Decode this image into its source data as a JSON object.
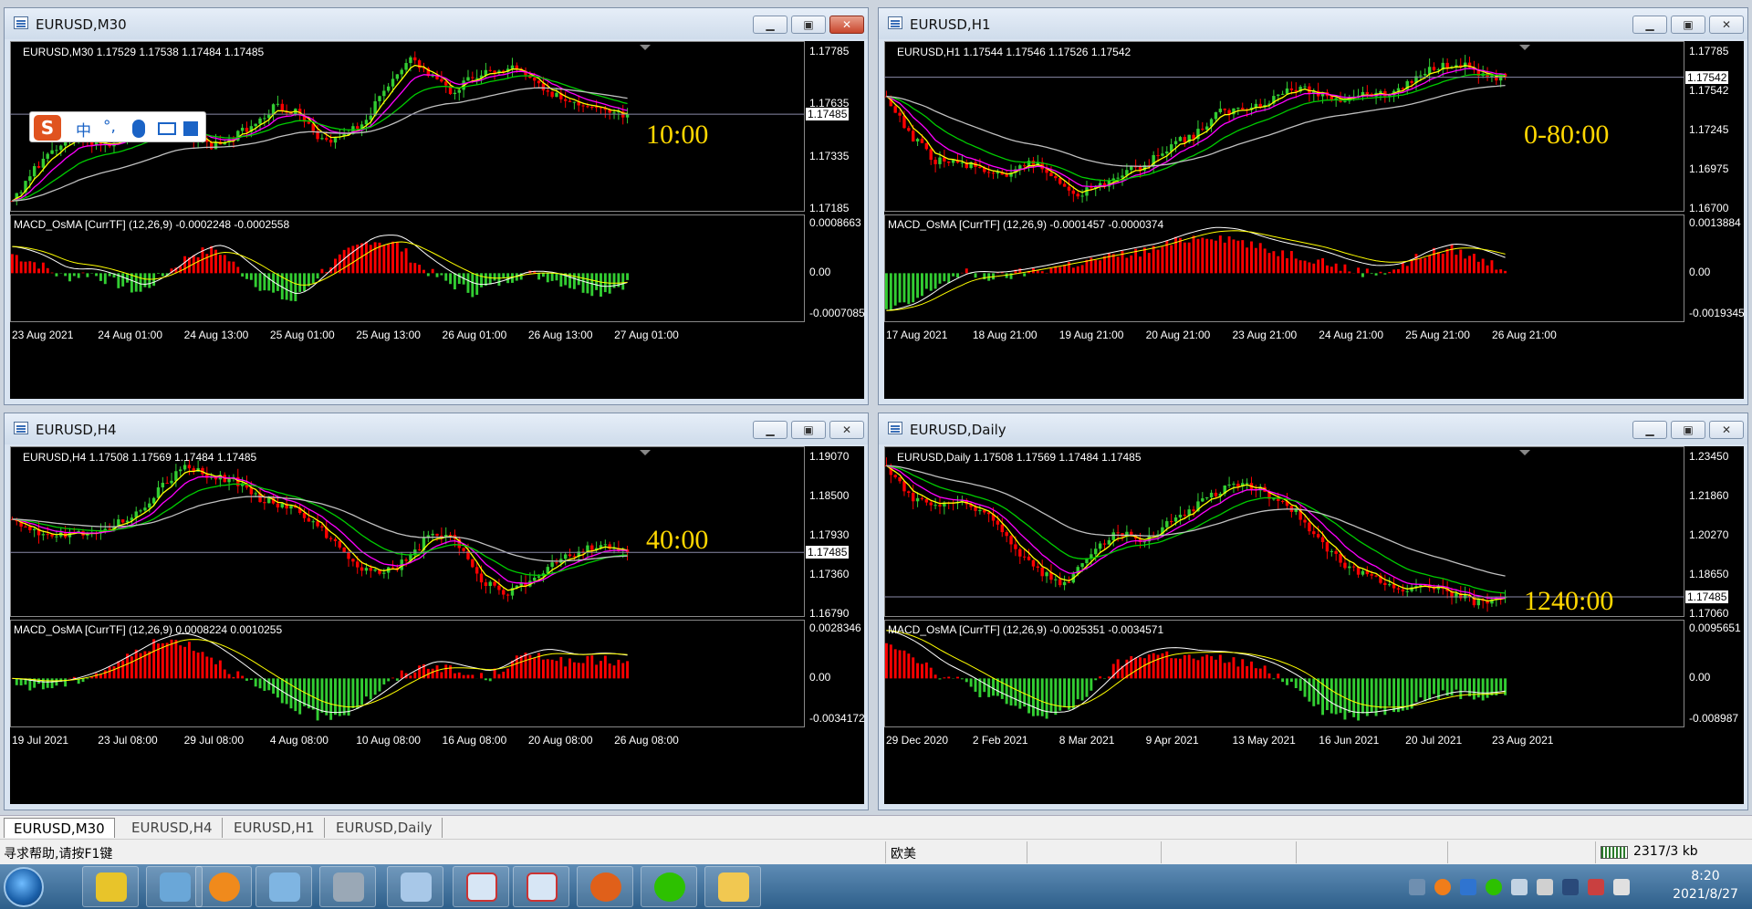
{
  "windows": [
    {
      "id": "m30",
      "title": "EURUSD,M30",
      "ohlc": "EURUSD,M30  1.17529 1.17538 1.17484 1.17485",
      "price_ticks": [
        "1.17785",
        "1.17635",
        "1.17335",
        "1.17185"
      ],
      "current_price": "1.17485",
      "tf_overlay": "10:00",
      "indicator_label": "MACD_OsMA [CurrTF] (12,26,9) -0.0002248 -0.0002558",
      "ind_ticks": [
        "0.0008663",
        "0.00",
        "-0.0007085"
      ],
      "date_ticks": [
        "23 Aug 2021",
        "24 Aug 01:00",
        "24 Aug 13:00",
        "25 Aug 01:00",
        "25 Aug 13:00",
        "26 Aug 01:00",
        "26 Aug 13:00",
        "27 Aug 01:00"
      ],
      "active": true
    },
    {
      "id": "h1",
      "title": "EURUSD,H1",
      "ohlc": "EURUSD,H1  1.17544 1.17546 1.17526 1.17542",
      "price_ticks": [
        "1.17785",
        "1.17542",
        "1.17245",
        "1.16975",
        "1.16700"
      ],
      "current_price": "1.17542",
      "tf_overlay": "0-80:00",
      "indicator_label": "MACD_OsMA [CurrTF] (12,26,9) -0.0001457 -0.0000374",
      "ind_ticks": [
        "0.0013884",
        "0.00",
        "-0.0019345"
      ],
      "date_ticks": [
        "17 Aug 2021",
        "18 Aug 21:00",
        "19 Aug 21:00",
        "20 Aug 21:00",
        "23 Aug 21:00",
        "24 Aug 21:00",
        "25 Aug 21:00",
        "26 Aug 21:00"
      ],
      "active": false
    },
    {
      "id": "h4",
      "title": "EURUSD,H4",
      "ohlc": "EURUSD,H4  1.17508 1.17569 1.17484 1.17485",
      "price_ticks": [
        "1.19070",
        "1.18500",
        "1.17930",
        "1.17360",
        "1.16790"
      ],
      "current_price": "1.17485",
      "tf_overlay": "40:00",
      "indicator_label": "MACD_OsMA [CurrTF] (12,26,9) 0.0008224 0.0010255",
      "ind_ticks": [
        "0.0028346",
        "0.00",
        "-0.0034172"
      ],
      "date_ticks": [
        "19 Jul 2021",
        "23 Jul 08:00",
        "29 Jul 08:00",
        "4 Aug 08:00",
        "10 Aug 08:00",
        "16 Aug 08:00",
        "20 Aug 08:00",
        "26 Aug 08:00"
      ],
      "active": false
    },
    {
      "id": "daily",
      "title": "EURUSD,Daily",
      "ohlc": "EURUSD,Daily  1.17508 1.17569 1.17484 1.17485",
      "price_ticks": [
        "1.23450",
        "1.21860",
        "1.20270",
        "1.18650",
        "1.17060"
      ],
      "current_price": "1.17485",
      "tf_overlay": "1240:00",
      "indicator_label": "MACD_OsMA [CurrTF] (12,26,9) -0.0025351 -0.0034571",
      "ind_ticks": [
        "0.0095651",
        "0.00",
        "-0.008987"
      ],
      "date_ticks": [
        "29 Dec 2020",
        "2 Feb 2021",
        "8 Mar 2021",
        "9 Apr 2021",
        "13 May 2021",
        "16 Jun 2021",
        "20 Jul 2021",
        "23 Aug 2021"
      ],
      "active": false
    }
  ],
  "window_buttons": {
    "minimize": "▁",
    "maximize": "▣",
    "close": "✕"
  },
  "tabs": [
    "EURUSD,M30",
    "EURUSD,H4",
    "EURUSD,H1",
    "EURUSD,Daily"
  ],
  "status": {
    "help": "寻求帮助,请按F1键",
    "profile": "欧美",
    "traffic": "2317/3 kb"
  },
  "ime": {
    "logo": "S",
    "mode": "中",
    "punct": "°,"
  },
  "clock": {
    "time": "8:20",
    "date": "2021/8/27"
  },
  "colors": {
    "bull": "#32cd32",
    "bear": "#ff0000",
    "ma_fast": "#ffff00",
    "ma_mid": "#ff00ff",
    "ma_slow": "#00cc00",
    "ma_long": "#c0c0c0",
    "hist_up": "#ff0000",
    "hist_down": "#32cd32"
  }
}
